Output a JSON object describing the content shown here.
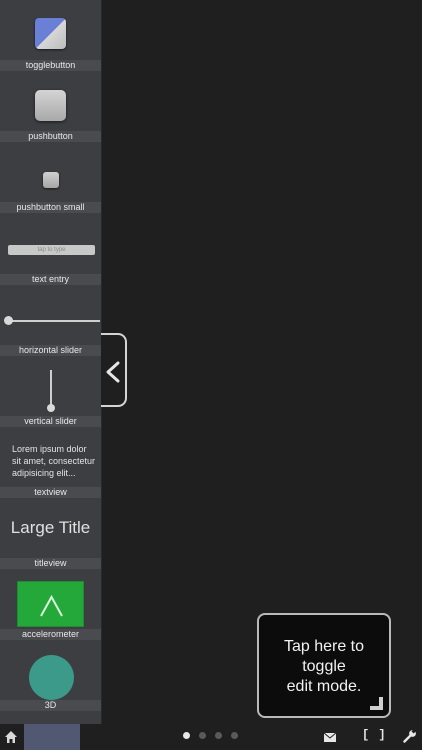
{
  "sidebar": {
    "widgets": [
      {
        "label": "togglebutton"
      },
      {
        "label": "pushbutton"
      },
      {
        "label": "pushbutton small"
      },
      {
        "label": "text entry",
        "placeholder": "tap to type"
      },
      {
        "label": "horizontal slider",
        "value": 0.0
      },
      {
        "label": "vertical slider",
        "value": 0.0
      },
      {
        "label": "textview",
        "sample_text": "Lorem ipsum dolor sit amet, consectetur adipisicing elit..."
      },
      {
        "label": "titleview",
        "sample_text": "Large Title"
      },
      {
        "label": "accelerometer"
      },
      {
        "label": "3D"
      }
    ]
  },
  "tooltip": {
    "text": "Tap here to\ntoggle\nedit mode."
  },
  "bottombar": {
    "page_count": 4,
    "active_page": 1,
    "brackets_label": "[ ]"
  },
  "colors": {
    "background": "#1f1f1f",
    "sidebar": "#3d3e42",
    "accelerometer_green": "#25a83a",
    "threed_teal": "#3b9a8a",
    "toggle_blue": "#6a7fd6"
  },
  "icons": [
    "home-icon",
    "mail-icon",
    "wrench-icon",
    "chevron-left-icon",
    "resize-corner-icon",
    "chevron-up-icon"
  ]
}
